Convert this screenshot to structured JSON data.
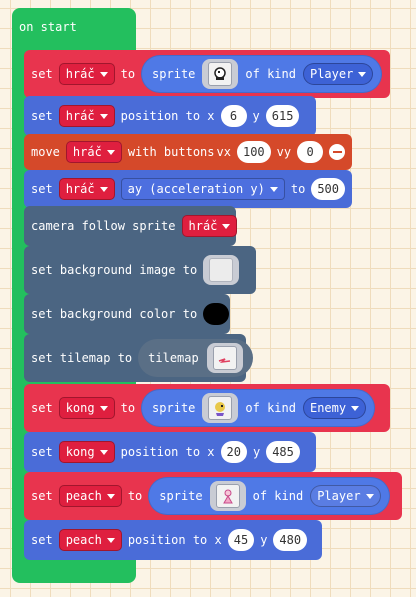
{
  "hat": {
    "label": "on start",
    "color": "#23bf5e"
  },
  "colors": {
    "variables": "#e8344e",
    "sprites": "#4a6cd8",
    "controller": "#d5492a",
    "scene": "#4b6582"
  },
  "blocks": {
    "b1": {
      "set": "set",
      "var": "hráč",
      "to": "to",
      "sprite": "sprite",
      "icon": "player-sprite-icon",
      "ofkind": "of kind",
      "kind": "Player"
    },
    "b2": {
      "set": "set",
      "var": "hráč",
      "pos": "position to x",
      "x": "6",
      "y_label": "y",
      "y": "615"
    },
    "b3": {
      "move": "move",
      "var": "hráč",
      "buttons": "with buttons",
      "vx_label": "vx",
      "vx": "100",
      "vy_label": "vy",
      "vy": "0"
    },
    "b4": {
      "set": "set",
      "var": "hráč",
      "prop": "ay (acceleration y)",
      "to": "to",
      "val": "500"
    },
    "b5": {
      "text": "camera follow sprite",
      "var": "hráč"
    },
    "b6": {
      "text": "set background image to"
    },
    "b7": {
      "text": "set background color to",
      "color": "#000000"
    },
    "b8": {
      "text": "set tilemap to",
      "tilemap": "tilemap"
    },
    "b9": {
      "set": "set",
      "var": "kong",
      "to": "to",
      "sprite": "sprite",
      "icon": "kong-sprite-icon",
      "ofkind": "of kind",
      "kind": "Enemy"
    },
    "b10": {
      "set": "set",
      "var": "kong",
      "pos": "position to x",
      "x": "20",
      "y_label": "y",
      "y": "485"
    },
    "b11": {
      "set": "set",
      "var": "peach",
      "to": "to",
      "sprite": "sprite",
      "icon": "peach-sprite-icon",
      "ofkind": "of kind",
      "kind": "Player"
    },
    "b12": {
      "set": "set",
      "var": "peach",
      "pos": "position to x",
      "x": "45",
      "y_label": "y",
      "y": "480"
    }
  }
}
